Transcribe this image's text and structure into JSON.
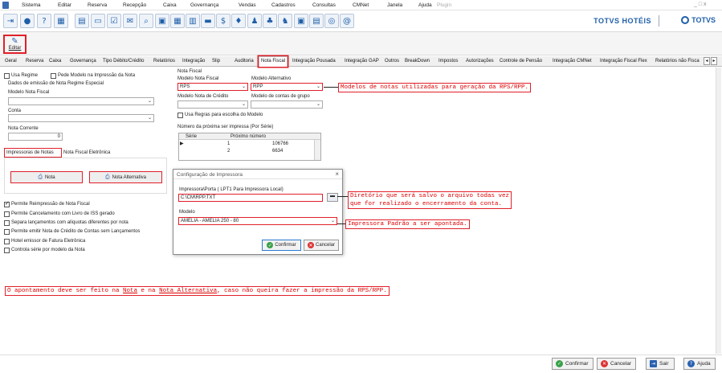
{
  "menu": {
    "items": [
      "Sistema",
      "Editar",
      "Reserva",
      "Recepção",
      "Caixa",
      "Governança",
      "Vendas",
      "Cadastros",
      "Consultas",
      "CMNet",
      "Janela",
      "Ajuda"
    ],
    "disabled_item": "Plugin",
    "window_controls": "_ □ x"
  },
  "toolbar": {
    "icons": [
      "exit-icon",
      "user-icon",
      "help-icon",
      "calendar-icon",
      "form-icon",
      "card-icon",
      "checklist-icon",
      "mail-icon",
      "search-icon",
      "calc-icon",
      "grid-icon",
      "chart-icon",
      "folder-icon",
      "dollar-icon",
      "bell-icon",
      "people-icon",
      "group-icon",
      "people2-icon",
      "screen-icon",
      "doc-icon",
      "user-search-icon",
      "at-icon"
    ],
    "brand": "TOTVS HOTÉIS",
    "brand_right": "TOTVS",
    "colors": {
      "icon": "#1f5fa8",
      "accent_red": "#e0202a"
    }
  },
  "edit": {
    "label": "Editar"
  },
  "tabs": {
    "items": [
      "Geral",
      "Reserva",
      "Caixa",
      "Governança",
      "Tipo Débito/Crédito",
      "Relatórios",
      "Integração",
      "Slip",
      "Auditoria",
      "Nota Fiscal",
      "Integração Pousada",
      "Integração GAP",
      "Outros",
      "BreakDown",
      "Impostos",
      "Autorizações",
      "Controle de Pensão",
      "Integração CMNet",
      "Integração Fiscal Flex",
      "Relatórios não Fisca"
    ],
    "active": "Nota Fiscal"
  },
  "left": {
    "usa_regime": "Usa Regime",
    "pede_modelo": "Pede Modelo na Impressão da Nota",
    "dados_label": "Dados de emissão de Nota Regime Especial",
    "modelo_label": "Modelo Nota Fiscal",
    "conta_label": "Conta",
    "nota_corrente_label": "Nota Corrente",
    "nota_corrente_value": "0",
    "subtabs": [
      "Impressoras de Notas",
      "Nota Fiscal Eletrônica"
    ],
    "btn_nota": "Nota",
    "btn_nota_alt": "Nota Alternativa",
    "options": [
      {
        "label": "Permite Reimpressão de Nota Fiscal",
        "checked": true
      },
      {
        "label": "Permite Cancelamento com Livro de ISS gerado",
        "checked": false
      },
      {
        "label": "Separa lançamentos com alíquotas diferentes por nota",
        "checked": false
      },
      {
        "label": "Permite emitir Nota de Crédito de Contas sem Lançamentos",
        "checked": false
      },
      {
        "label": "Hotel emissor de Fatura Eletrônica",
        "checked": false
      },
      {
        "label": "Controla série por modelo da Nota",
        "checked": false
      }
    ]
  },
  "mid": {
    "nota_fiscal": "Nota Fiscal",
    "modelo_nf_label": "Modelo Nota Fiscal",
    "modelo_nf_value": "RPS",
    "modelo_alt_label": "Modelo Alternativo",
    "modelo_alt_value": "RPP",
    "modelo_credito_label": "Modelo Nota de Crédito",
    "modelo_contas_label": "Modelo de contas de grupo",
    "usa_regras": "Usa Regras para escolha do Modelo",
    "proxima_label": "Número da próxima ser impressa (Por Série)",
    "grid_headers": [
      "Série",
      "Próximo número"
    ],
    "grid_rows": [
      [
        "1",
        "106766"
      ],
      [
        "2",
        "6634"
      ]
    ]
  },
  "dialog": {
    "title": "Configuração de Impressora",
    "porta_label": "Impressora\\Porta ( LPT1 Para Impressora Local)",
    "porta_value": "C:\\CM\\RPP.TXT",
    "modelo_label": "Modelo",
    "modelo_value": "AMELIA - AMELIA 250 - 80",
    "confirm": "Confirmar",
    "cancel": "Cancelar"
  },
  "annotations": {
    "models": "Modelos de notas utilizadas para geração da RPS/RPP.",
    "dir_line1": "Diretório que será salvo o arquivo todas vez",
    "dir_line2": "que for realizado o encerramento da conta.",
    "printer": "Impressora Padrão a ser apontada.",
    "bottom_pre": "O apontamento deve ser feito na ",
    "bottom_nota": "Nota",
    "bottom_mid": " e na ",
    "bottom_alt": "Nota Alternativa",
    "bottom_post": ", caso não queira fazer a impressão da RPS/RPP."
  },
  "footer": {
    "confirm": "Confirmar",
    "cancel": "Cancelar",
    "exit": "Sair",
    "help": "Ajuda"
  }
}
